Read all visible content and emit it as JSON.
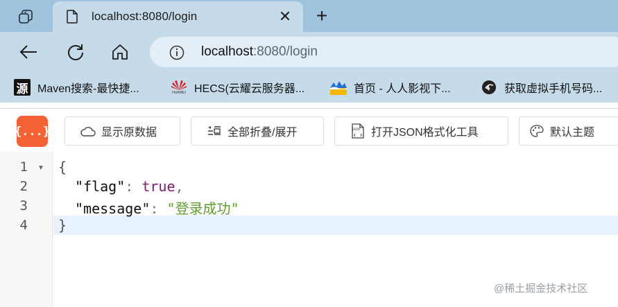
{
  "browser": {
    "tab": {
      "title": "localhost:8080/login",
      "close": "✕"
    },
    "new_tab": "+",
    "address": {
      "host": "localhost",
      "rest": ":8080/login"
    },
    "bookmarks": [
      {
        "label": "Maven搜索-最快捷...",
        "icon": "maven-icon"
      },
      {
        "label": "HECS(云耀云服务器...",
        "icon": "huawei-icon"
      },
      {
        "label": "首页 - 人人影视下...",
        "icon": "rrys-icon"
      },
      {
        "label": "获取虚拟手机号码...",
        "icon": "phone-number-icon"
      }
    ],
    "maven_glyph": "源",
    "huawei_text": "HUAWEI"
  },
  "viewer": {
    "logo": "{...}",
    "buttons": [
      {
        "label": "显示原数据",
        "icon": "cloud-icon"
      },
      {
        "label": "全部折叠/展开",
        "icon": "collapse-icon"
      },
      {
        "label": "打开JSON格式化工具",
        "icon": "json-file-icon"
      },
      {
        "label": "默认主题",
        "icon": "palette-icon"
      }
    ],
    "json_icon_text": "json"
  },
  "editor": {
    "line_numbers": [
      "1",
      "2",
      "3",
      "4"
    ],
    "lines": {
      "open_brace": "{",
      "flag_key": "\"flag\"",
      "colon": ":",
      "flag_value": "true",
      "comma": ",",
      "message_key": "\"message\"",
      "message_value": "\"登录成功\"",
      "close_brace": "}"
    }
  },
  "watermark": "@稀土掘金技术社区",
  "colors": {
    "accent": "#f46135",
    "chrome": "#c5dbea",
    "tabstrip": "#9fc3dc",
    "bool": "#801b72",
    "string": "#5e9d2e"
  }
}
